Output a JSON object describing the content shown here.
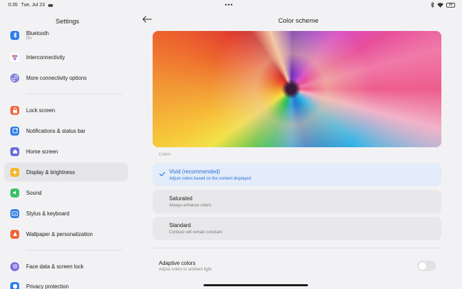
{
  "status_bar": {
    "time": "0:35",
    "date": "Tue, Jul 23",
    "battery": "99",
    "dots": "•••"
  },
  "sidebar": {
    "title": "Settings",
    "items": [
      {
        "label": "Bluetooth",
        "sub": "On",
        "icon": "bluetooth-icon",
        "color": "#2f7de6"
      },
      {
        "label": "Interconnectivity",
        "icon": "interconnect-icon",
        "color": "#ffffff"
      },
      {
        "label": "More connectivity options",
        "icon": "link-icon",
        "color": "#7b7fd8"
      },
      {
        "label": "Lock screen",
        "icon": "lock-icon",
        "color": "#f0653a"
      },
      {
        "label": "Notifications & status bar",
        "icon": "notification-icon",
        "color": "#2f7de6"
      },
      {
        "label": "Home screen",
        "icon": "home-icon",
        "color": "#6b6be0"
      },
      {
        "label": "Display & brightness",
        "icon": "sun-icon",
        "color": "#f5b52a"
      },
      {
        "label": "Sound",
        "icon": "sound-icon",
        "color": "#39c06a"
      },
      {
        "label": "Stylus & keyboard",
        "icon": "keyboard-icon",
        "color": "#2f7de6"
      },
      {
        "label": "Wallpaper & personalization",
        "icon": "wallpaper-icon",
        "color": "#f0653a"
      },
      {
        "label": "Face data & screen lock",
        "icon": "face-icon",
        "color": "#7b6be0"
      },
      {
        "label": "Privacy protection",
        "icon": "privacy-icon",
        "color": "#2f7de6"
      }
    ]
  },
  "main": {
    "title": "Color scheme",
    "section_label": "Colors",
    "options": [
      {
        "title": "Vivid (recommended)",
        "desc": "Adjust colors based on the content displayed",
        "selected": true
      },
      {
        "title": "Saturated",
        "desc": "Always enhance colors",
        "selected": false
      },
      {
        "title": "Standard",
        "desc": "Contrast will remain constant",
        "selected": false
      }
    ],
    "adaptive": {
      "title": "Adaptive colors",
      "desc": "Adjust colors to ambient light",
      "enabled": false
    }
  },
  "colors": {
    "accent": "#2a6fd8",
    "selected_bg": "#e3ecf9"
  }
}
